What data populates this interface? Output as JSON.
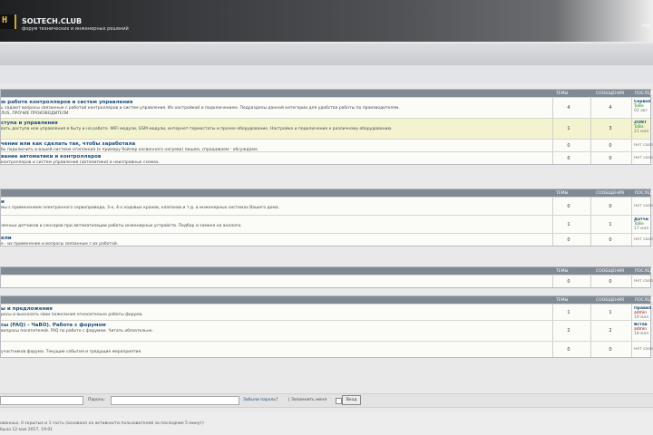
{
  "header": {
    "logo_glyph": "H",
    "title": "SOLTECH.CLUB",
    "subtitle": "форум технических и инженерных решений",
    "lang": "mo"
  },
  "categories": [
    {
      "columns": [
        "ТЕМЫ",
        "СООБЩЕНИЯ",
        "ПОСЛЕДН"
      ],
      "forums": [
        {
          "title": "ю работе контроллеров и систем управления",
          "desc": "ь задают вопросы связанные с работой контроллеров и систем управления. Их настройкой и подключением. Подразделы данной категории для удобства работы по производителям.",
          "desc2": "ЛUS, ПРОЧИЕ ПРОИЗВОДИТЕЛИ",
          "topics": "4",
          "posts": "4",
          "last_title": "Сервоп",
          "last_user": "ToBe",
          "last_date": "02 авг",
          "highlight": false
        },
        {
          "title": "ступа и управления",
          "desc": "вать доступа или управления в быту и на работе. WiFi модули, GSM модули, интернет-термостаты и прочее оборудование. Настройка и подключение к различному оборудованию.",
          "desc2": "",
          "topics": "1",
          "posts": "3",
          "last_title": "ZONT",
          "last_user": "ToBe",
          "last_date": "21 мая",
          "highlight": true
        },
        {
          "title": "чение или как сделать так, чтобы заработала",
          "desc": "бь подключить в вашей системе отопления (к примеру бойлер косвенного нагрева) пишем, спрашиваем - обсуждаем.",
          "desc2": "",
          "topics": "0",
          "posts": "0",
          "last_title": "",
          "last_user": "",
          "last_date": "Нет сооб",
          "highlight": false
        },
        {
          "title": "вание автоматики и контроллеров",
          "desc": "контроллеров и систем управления (автоматики) в неисправных схемах.",
          "desc2": "",
          "topics": "0",
          "posts": "0",
          "last_title": "",
          "last_user": "",
          "last_date": "Нет сооб",
          "highlight": false
        }
      ]
    },
    {
      "columns": [
        "ТЕМЫ",
        "СООБЩЕНИЯ",
        "ПОСЛЕДН"
      ],
      "forums": [
        {
          "title": "и",
          "desc": "мы с применением электронного сервопривода, 3-х, 4-х ходовых кранов, клапанов и т.д. в инженерных системах Вашего дома.",
          "desc2": "",
          "topics": "0",
          "posts": "0",
          "last_title": "",
          "last_user": "",
          "last_date": "Нет сооб",
          "highlight": false
        },
        {
          "title": "",
          "desc": "личных датчиков и сенсоров при автоматизации работы инженерных устройств. Подбор и замена на аналоги.",
          "desc2": "",
          "topics": "1",
          "posts": "1",
          "last_title": "Датчи",
          "last_user": "ToBe",
          "last_date": "17 мая",
          "highlight": false
        },
        {
          "title": "ели",
          "desc": "е - их применение и вопросы связанные с их работой.",
          "desc2": "",
          "topics": "0",
          "posts": "0",
          "last_title": "",
          "last_user": "",
          "last_date": "Нет сооб",
          "highlight": false
        }
      ]
    },
    {
      "columns": [
        "ТЕМЫ",
        "СООБЩЕНИЯ",
        "ПОСЛЕДН"
      ],
      "forums": [
        {
          "title": "",
          "desc": "",
          "desc2": "",
          "topics": "0",
          "posts": "0",
          "last_title": "",
          "last_user": "",
          "last_date": "Нет сооб",
          "highlight": false
        }
      ]
    },
    {
      "columns": [
        "ТЕМЫ",
        "СООБЩЕНИЯ",
        "ПОСЛЕДН"
      ],
      "forums": [
        {
          "title": "ы и предложения",
          "desc": "росы и высказать свои пожелания относительно работы форума.",
          "desc2": "",
          "topics": "1",
          "posts": "1",
          "last_title": "Правил",
          "last_user": "admin",
          "last_date": "19 мая",
          "highlight": false
        },
        {
          "title": "сы (FAQ) - ЧаВО). Работа с форумом",
          "desc": "вопросы посетителей. FAQ по работе с форумом. Читать обязательно.",
          "desc2": "",
          "topics": "2",
          "posts": "2",
          "last_title": "Встав",
          "last_user": "admin",
          "last_date": "18 мая",
          "highlight": false
        },
        {
          "title": "",
          "desc": "участников форума. Текущие события и грядущие мероприятия.",
          "desc2": "",
          "topics": "0",
          "posts": "0",
          "last_title": "",
          "last_user": "",
          "last_date": "Нет сооб",
          "highlight": false
        }
      ]
    }
  ],
  "login": {
    "password_label": "Пароль:",
    "forgot": "Забыли пароль?",
    "remember": "| Запомнить меня",
    "submit": "Вход"
  },
  "footer": {
    "line1": "ованных, 0 скрытых и 1 гость (основано на активности пользователей за последние 5 минут)",
    "line2": "было 12 мая 2017, 19:01"
  }
}
